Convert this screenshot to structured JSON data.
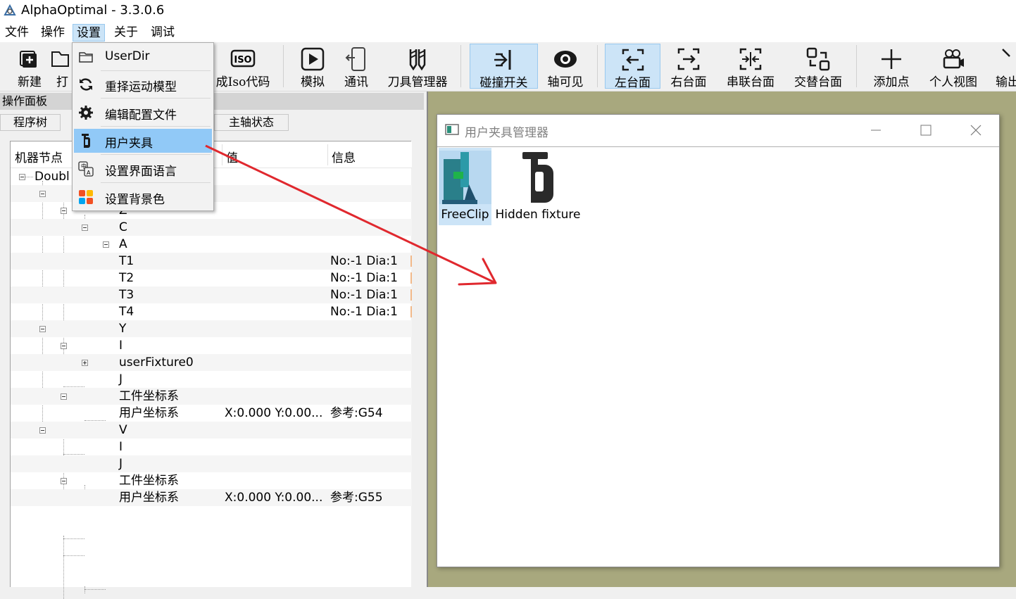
{
  "app": {
    "title": "AlphaOptimal  - 3.3.0.6"
  },
  "menubar": [
    "文件",
    "操作",
    "设置",
    "关于",
    "调试"
  ],
  "toolbar": {
    "new": "新建",
    "open_partial": "打",
    "iso_partial": "成Iso代码",
    "simulate": "模拟",
    "comm": "通讯",
    "tool_manager": "刀具管理器",
    "collision": "碰撞开关",
    "axis_visible": "轴可见",
    "left_table": "左台面",
    "right_table": "右台面",
    "serial_table": "串联台面",
    "alt_table": "交替台面",
    "add_point": "添加点",
    "personal_view": "个人视图",
    "output_partial": "输出"
  },
  "panel": {
    "title": "操作面板",
    "tabs": [
      "程序树",
      "主轴状态"
    ],
    "columns": {
      "node": "机器节点",
      "value": "值",
      "info": "信息"
    },
    "rows": [
      {
        "node": "Doubl",
        "value": "",
        "info": ""
      },
      {
        "node": "",
        "value": "",
        "info": ""
      },
      {
        "node": "Z",
        "value": "",
        "info": ""
      },
      {
        "node": "C",
        "value": "",
        "info": ""
      },
      {
        "node": "A",
        "value": "",
        "info": ""
      },
      {
        "node": "T1",
        "value": "",
        "info": "No:-1  Dia:1"
      },
      {
        "node": "T2",
        "value": "",
        "info": "No:-1  Dia:1"
      },
      {
        "node": "T3",
        "value": "",
        "info": "No:-1  Dia:1"
      },
      {
        "node": "T4",
        "value": "",
        "info": "No:-1  Dia:1"
      },
      {
        "node": "Y",
        "value": "",
        "info": ""
      },
      {
        "node": "I",
        "value": "",
        "info": ""
      },
      {
        "node": "userFixture0",
        "value": "",
        "info": ""
      },
      {
        "node": "J",
        "value": "",
        "info": ""
      },
      {
        "node": "工件坐标系",
        "value": "",
        "info": ""
      },
      {
        "node": "用户坐标系",
        "value": "X:0.000 Y:0.00...",
        "info": "参考:G54"
      },
      {
        "node": "V",
        "value": "",
        "info": ""
      },
      {
        "node": "I",
        "value": "",
        "info": ""
      },
      {
        "node": "J",
        "value": "",
        "info": ""
      },
      {
        "node": "工件坐标系",
        "value": "",
        "info": ""
      },
      {
        "node": "用户坐标系",
        "value": "X:0.000 Y:0.00...",
        "info": "参考:G55"
      }
    ]
  },
  "settings_menu": {
    "items": [
      "UserDir",
      "重择运动模型",
      "编辑配置文件",
      "用户夹具",
      "设置界面语言",
      "设置背景色"
    ],
    "active": "用户夹具"
  },
  "dialog": {
    "title": "用户夹具管理器",
    "fixtures": [
      "FreeClip",
      "Hidden fixture"
    ],
    "selected": "FreeClip"
  },
  "colors": {
    "accent": "#cce4f7",
    "menu_highlight": "#91c9f7",
    "viewport_bg": "#a8a87e",
    "annotation_arrow": "#e0282e"
  }
}
